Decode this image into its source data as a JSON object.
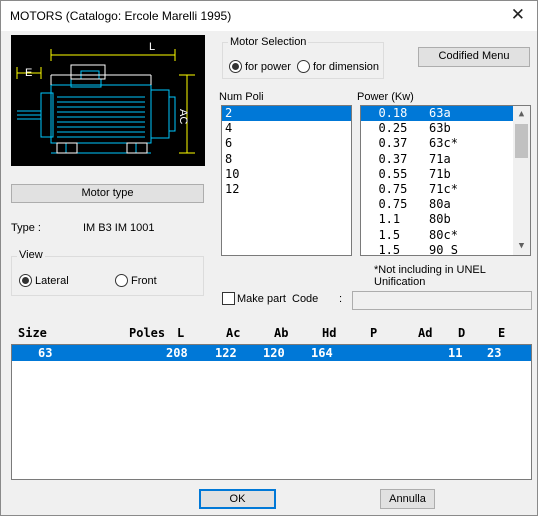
{
  "window": {
    "title": "MOTORS (Catalogo: Ercole Marelli 1995)",
    "close_glyph": "✕"
  },
  "drawing": {
    "label_L": "L",
    "label_E": "E",
    "label_AC": "AC"
  },
  "motor_type_button": "Motor type",
  "type": {
    "label": "Type  :",
    "value": "IM B3 IM 1001"
  },
  "view": {
    "legend": "View",
    "options": [
      {
        "label": "Lateral",
        "selected": true
      },
      {
        "label": "Front",
        "selected": false
      }
    ]
  },
  "motor_selection": {
    "legend": "Motor Selection",
    "options": [
      {
        "label": "for power",
        "selected": true
      },
      {
        "label": "for dimension",
        "selected": false
      }
    ]
  },
  "codified_menu_button": "Codified Menu",
  "num_poli": {
    "label": "Num Poli",
    "items": [
      "2",
      "4",
      "6",
      "8",
      "10",
      "12"
    ],
    "selected_index": 0
  },
  "power": {
    "label": "Power (Kw)",
    "items": [
      "  0.18   63a",
      "  0.25   63b",
      "  0.37   63c*",
      "  0.37   71a",
      "  0.55   71b",
      "  0.75   71c*",
      "  0.75   80a",
      "  1.1    80b",
      "  1.5    80c*",
      "  1.5    90 S"
    ],
    "selected_index": 0
  },
  "note": "*Not including in UNEL Unification",
  "make_part": {
    "label": "Make part",
    "checked": false
  },
  "code": {
    "label": "Code",
    "separator": ":",
    "value": ""
  },
  "table": {
    "headers": [
      "Size",
      "Poles",
      "L",
      "Ac",
      "Ab",
      "Hd",
      "P",
      "Ad",
      "D",
      "E"
    ],
    "rows": [
      {
        "Size": "63",
        "Poles": "",
        "L": "208",
        "Ac": "122",
        "Ab": "120",
        "Hd": "164",
        "P": "",
        "Ad": "",
        "D": "11",
        "E": "23"
      }
    ]
  },
  "ok_button": "OK",
  "cancel_button": "Annulla"
}
